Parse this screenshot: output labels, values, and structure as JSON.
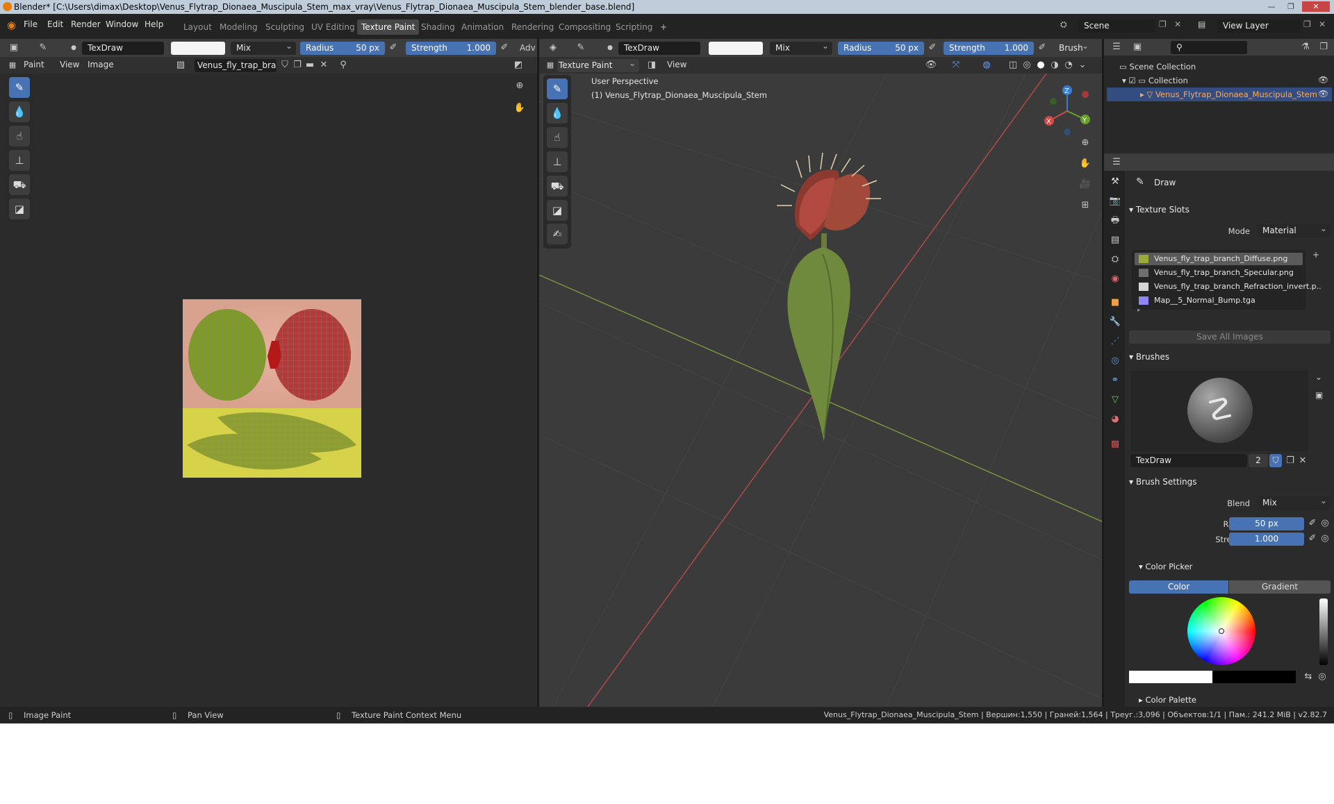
{
  "window": {
    "title": "Blender* [C:\\Users\\dimax\\Desktop\\Venus_Flytrap_Dionaea_Muscipula_Stem_max_vray\\Venus_Flytrap_Dionaea_Muscipula_Stem_blender_base.blend]",
    "controls": [
      "—",
      "❐",
      "✕"
    ]
  },
  "menu": [
    "File",
    "Edit",
    "Render",
    "Window",
    "Help"
  ],
  "workspaces": [
    "Layout",
    "Modeling",
    "Sculpting",
    "UV Editing",
    "Texture Paint",
    "Shading",
    "Animation",
    "Rendering",
    "Compositing",
    "Scripting",
    "+"
  ],
  "active_workspace": "Texture Paint",
  "scene": {
    "name": "Scene",
    "view_layer": "View Layer"
  },
  "image_editor": {
    "brush_name": "TexDraw",
    "blend": "Mix",
    "radius_label": "Radius",
    "radius_value": "50 px",
    "strength_label": "Strength",
    "strength_value": "1.000",
    "adv_label": "Adv",
    "mode_label": "Paint",
    "view_menu": "View",
    "image_menu": "Image",
    "image_name": "Venus_fly_trap_bran.."
  },
  "viewport": {
    "brush_name": "TexDraw",
    "blend": "Mix",
    "radius_label": "Radius",
    "radius_value": "50 px",
    "strength_label": "Strength",
    "strength_value": "1.000",
    "brush_menu": "Brush",
    "mode_label": "Texture Paint",
    "view_menu": "View",
    "perspective": "User Perspective",
    "object_label": "(1) Venus_Flytrap_Dionaea_Muscipula_Stem",
    "gizmo": {
      "z": "Z",
      "y": "Y",
      "x": "X"
    }
  },
  "outliner": {
    "scene_collection": "Scene Collection",
    "collection": "Collection",
    "object": "Venus_Flytrap_Dionaea_Muscipula_Stem"
  },
  "properties": {
    "brush_header": "Draw",
    "texture_slots": {
      "title": "Texture Slots",
      "mode_label": "Mode",
      "mode_value": "Material",
      "slots": [
        {
          "name": "Venus_fly_trap_branch_Diffuse.png",
          "color": "#9bab3a",
          "active": true
        },
        {
          "name": "Venus_fly_trap_branch_Specular.png",
          "color": "#6e6e6e",
          "active": false
        },
        {
          "name": "Venus_fly_trap_branch_Refraction_invert.p..",
          "color": "#d6d6d6",
          "active": false
        },
        {
          "name": "Map__5_Normal_Bump.tga",
          "color": "#8f86f5",
          "active": false
        }
      ],
      "save_all": "Save All Images"
    },
    "brushes": {
      "title": "Brushes",
      "name": "TexDraw",
      "users": "2"
    },
    "brush_settings": {
      "title": "Brush Settings",
      "blend_label": "Blend",
      "blend_value": "Mix",
      "radius_label": "Radius",
      "radius_value": "50 px",
      "strength_label": "Strength",
      "strength_value": "1.000"
    },
    "color_picker": {
      "title": "Color Picker",
      "tab_color": "Color",
      "tab_gradient": "Gradient"
    },
    "color_palette": "Color Palette"
  },
  "statusbar": {
    "left1": "Image Paint",
    "left2": "Pan View",
    "left3": "Texture Paint Context Menu",
    "right": "Venus_Flytrap_Dionaea_Muscipula_Stem | Вершин:1,550 | Граней:1,564 | Треуг.:3,096 | Объектов:1/1 | Пам.: 241.2 MiB | v2.82.7"
  },
  "colors": {
    "accent": "#4772b3",
    "bg": "#303030",
    "header": "#3d3d3d"
  }
}
